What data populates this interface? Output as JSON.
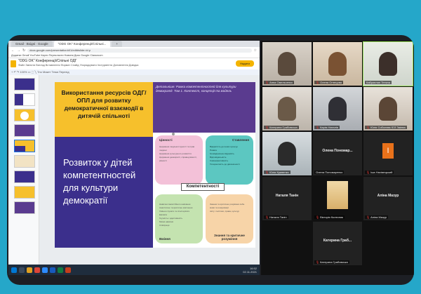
{
  "browser": {
    "tabs": [
      "Gmail · Вхідні · Google",
      "\"ODG OK\" Конференції/Спільні...",
      "+"
    ],
    "url": "docs.google.com/presentation/d/1/edit#slide=id.p",
    "bookmarks": "Додатки  Gmail  YouTube  Карти  Перекласти  Новини  Диск  Google Classroom",
    "doc_title": "\"ODG OK\" Конференції/Спільні ОДГ",
    "menu": "Файл  Змінити  Вигляд  Вставлення  Формат  Слайд  Упорядкувати  Інструменти  Доповнення  Довідка",
    "share_label": "Надати доступ",
    "toolbar": "+  ↶  ↷  100%  ▭  ⬚  ╲  Тло  Макет  Тема  Перехід"
  },
  "slide": {
    "gold_title": "Використання ресурсів ОДГ/ОПЛ для розвитку демократичної взаємодії в дитячій спільноті",
    "purple_title": "Розвиток у дітей компетентностей для культури демократії",
    "top_right_text": "Детальніше: Рамка компетентностей для культури демократії. Том 1. Контекст, концепції та модель",
    "center_label": "Компетентності",
    "q1_title": "Цінності",
    "q2_title": "Ставлення",
    "q3_title": "Вміння",
    "q4_title": "Знання та критичне розуміння",
    "q1_lines": "Цінування людської гідності та прав людини\nЦінування культурного розмаїття\nЦінування демократії, справедливості, рівності",
    "q2_lines": "Відкритість до інших культур\nПовага\nГромадянська свідомість\nВідповідальність\nСамоефективність\nТолерантність до двозначності",
    "q3_lines": "Навички самостійного навчання\nАналітичне та критичне мислення\nУміння слухати та спостерігати\nЕмпатія\nГнучкість і адаптивність\nМовні навички\nСпівпраця",
    "q4_lines": "Знання та критичне розуміння себе\nмови та комунікації\nсвіту: політики, права, культур"
  },
  "thumb_numbers": [
    "1",
    "2",
    "3",
    "4",
    "5",
    "6",
    "7",
    "8",
    "9"
  ],
  "taskbar_time": "16:52\n02.11.2021",
  "participants": [
    {
      "name": "Анна Омельченко",
      "cam": true
    },
    {
      "name": "Олена Огнецова",
      "cam": true
    },
    {
      "name": "Кабриелян Тетяна",
      "cam": true,
      "active": true
    },
    {
      "name": "Катерина Грабовська",
      "cam": true
    },
    {
      "name": "Карім Наталія",
      "cam": true
    },
    {
      "name": "Юлія Соболєва ЮЗ Змієва",
      "cam": true
    },
    {
      "name": "Юлія Кривенко",
      "cam": true
    },
    {
      "name": "Олена Пономаренко",
      "cam": false,
      "big": "Олена Пономар..."
    },
    {
      "name": "Іша Нахімецький",
      "cam": false,
      "initial": "I"
    },
    {
      "name": "Наталя Танін",
      "cam": false,
      "big": "Наталя Танін"
    },
    {
      "name": "Вікторія Колесник",
      "cam": true
    },
    {
      "name": "Аліна Мазур",
      "cam": false,
      "big": "Аліна Мазур"
    },
    {
      "name": "Катерина Грабовська",
      "cam": false,
      "big": "Катерина Граб..."
    }
  ]
}
